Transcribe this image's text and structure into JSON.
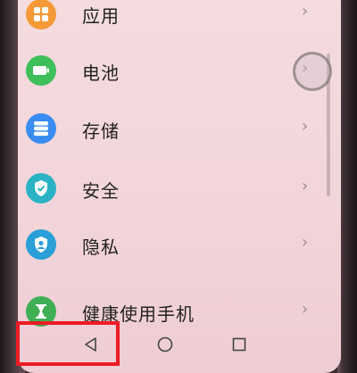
{
  "settings": {
    "items": [
      {
        "label": "应用",
        "icon": "apps-grid-icon",
        "color": "#f59a37"
      },
      {
        "label": "电池",
        "icon": "battery-icon",
        "color": "#3fbf5a"
      },
      {
        "label": "存储",
        "icon": "storage-icon",
        "color": "#3a8df0"
      },
      {
        "label": "安全",
        "icon": "security-shield-icon",
        "color": "#2ab3c4"
      },
      {
        "label": "隐私",
        "icon": "privacy-icon",
        "color": "#2a9fd8"
      },
      {
        "label": "健康使用手机",
        "icon": "hourglass-icon",
        "color": "#3fae54"
      }
    ],
    "chevron": "›"
  },
  "navbar": {
    "back_icon": "back-triangle-icon",
    "home_icon": "home-circle-icon",
    "recents_icon": "recents-square-icon"
  },
  "annotation": {
    "highlight_color": "#ee1b24"
  }
}
